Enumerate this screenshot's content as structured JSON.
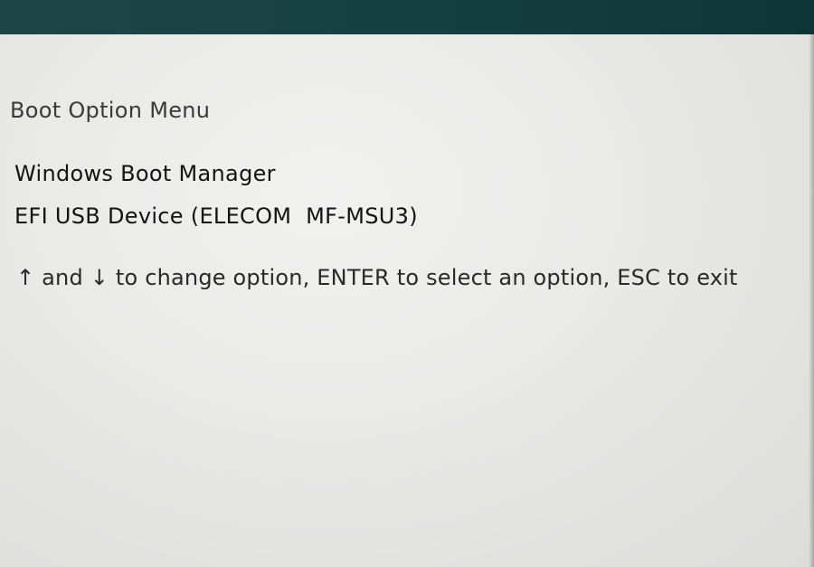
{
  "boot_menu": {
    "title": "Boot Option Menu",
    "options": [
      "Windows Boot Manager",
      "EFI USB Device (ELECOM  MF-MSU3)"
    ],
    "help": {
      "up_arrow": "↑",
      "and_text": " and ",
      "down_arrow": "↓",
      "rest_text": " to change option, ENTER to select an option, ESC to exit"
    }
  },
  "colors": {
    "top_bar": "#164042",
    "screen_background": "#e9e9e8",
    "text": "#141414"
  }
}
